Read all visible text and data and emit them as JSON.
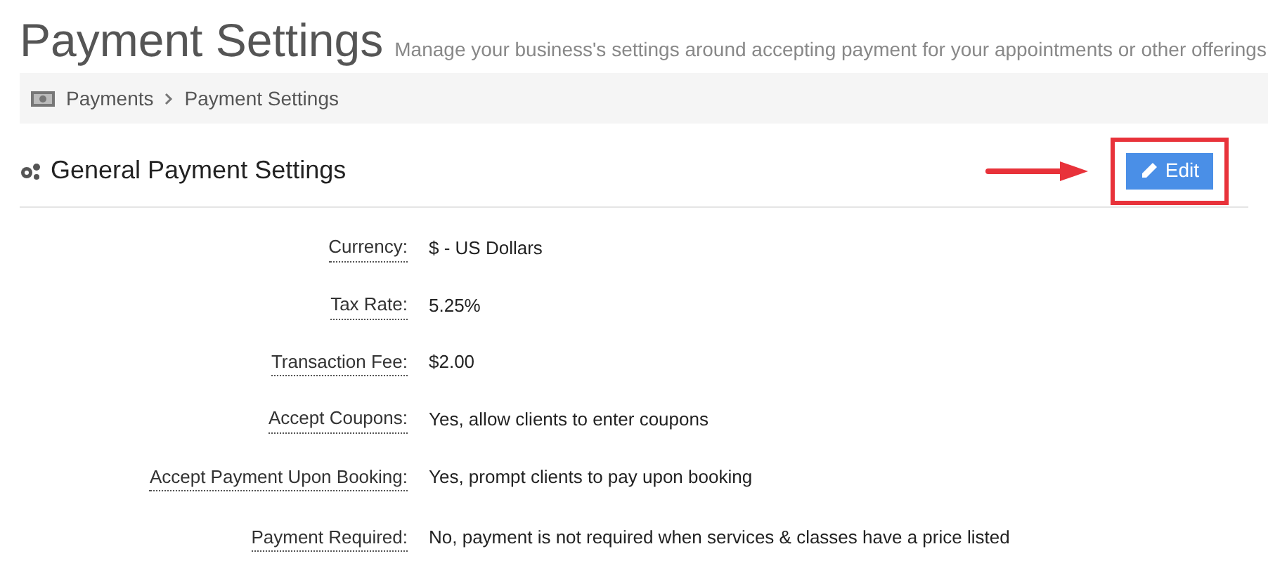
{
  "header": {
    "title": "Payment Settings",
    "subtitle": "Manage your business's settings around accepting payment for your appointments or other offerings"
  },
  "breadcrumb": [
    "Payments",
    "Payment Settings"
  ],
  "section": {
    "title": "General Payment Settings",
    "edit_button": "Edit"
  },
  "settings": [
    {
      "label": "Currency:",
      "value": "$ - US Dollars"
    },
    {
      "label": "Tax Rate:",
      "value": "5.25%"
    },
    {
      "label": "Transaction Fee:",
      "value": "$2.00"
    },
    {
      "label": "Accept Coupons:",
      "value": "Yes, allow clients to enter coupons"
    },
    {
      "label": "Accept Payment Upon Booking:",
      "value": "Yes, prompt clients to pay upon booking"
    },
    {
      "label": "Payment Required:",
      "value": "No, payment is not required when services & classes have a price listed"
    }
  ]
}
